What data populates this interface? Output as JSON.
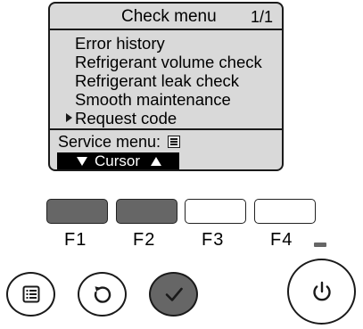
{
  "screen": {
    "title": "Check menu",
    "page": "1/1",
    "menu_items": [
      {
        "label": "Error history"
      },
      {
        "label": "Refrigerant volume check"
      },
      {
        "label": "Refrigerant leak check"
      },
      {
        "label": "Smooth maintenance"
      },
      {
        "label": "Request code",
        "selected": true
      }
    ],
    "service_label": "Service menu:",
    "cursor_label": "Cursor"
  },
  "function_keys": [
    {
      "label": "F1",
      "pressed": true
    },
    {
      "label": "F2",
      "pressed": true
    },
    {
      "label": "F3",
      "pressed": false
    },
    {
      "label": "F4",
      "pressed": false
    }
  ],
  "buttons": {
    "menu": "menu-icon",
    "back": "return-icon",
    "confirm": "checkmark-icon",
    "power": "power-icon"
  },
  "colors": {
    "lcd_background": "#d9d9d9",
    "pressed_key": "#666666",
    "led": "#666666"
  }
}
